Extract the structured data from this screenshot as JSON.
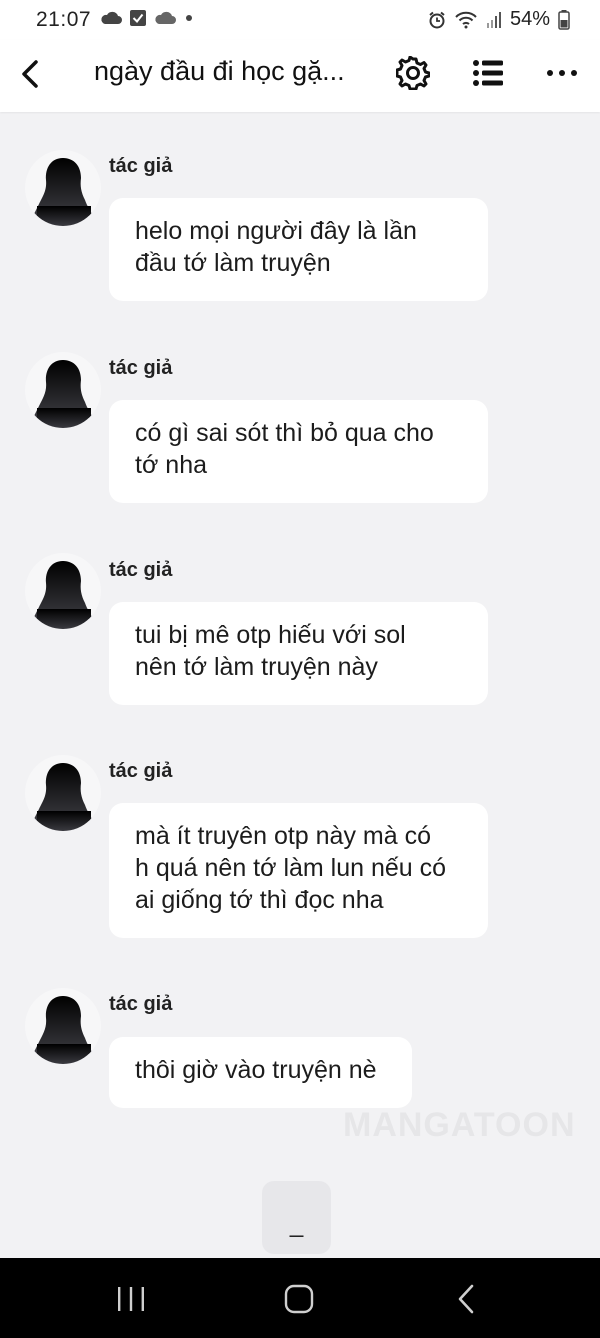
{
  "status_bar": {
    "time": "21:07",
    "battery": "54%",
    "left_icons": [
      "cloud-icon",
      "checkbox-icon",
      "cloud-icon",
      "dot-icon"
    ],
    "right_icons": [
      "alarm-icon",
      "wifi-icon",
      "signal-icon",
      "battery-icon"
    ]
  },
  "header": {
    "title": "ngày đầu đi học gặ...",
    "icons": [
      "back-icon",
      "gear-icon",
      "list-icon",
      "more-icon"
    ]
  },
  "messages": [
    {
      "author": "tác giả",
      "lines": [
        "helo mọi người đây là lần",
        "đầu tớ làm truyện"
      ]
    },
    {
      "author": "tác giả",
      "lines": [
        "có gì sai sót thì bỏ qua cho",
        "tớ nha"
      ]
    },
    {
      "author": "tác giả",
      "lines": [
        "tui bị mê otp hiếu với sol",
        "nên tớ làm truyện này"
      ]
    },
    {
      "author": "tác giả",
      "lines": [
        "mà ít truyên otp này mà có",
        "h quá nên tớ làm lun nếu có",
        "ai giống tớ thì đọc nha"
      ]
    },
    {
      "author": "tác giả",
      "lines": [
        "thôi giờ vào truyện nè"
      ]
    }
  ],
  "watermark": "MANGATOON",
  "load_button": {
    "label": "_"
  },
  "nav_bar": {
    "icons": [
      "recent-apps-icon",
      "home-icon",
      "back-nav-icon"
    ]
  }
}
